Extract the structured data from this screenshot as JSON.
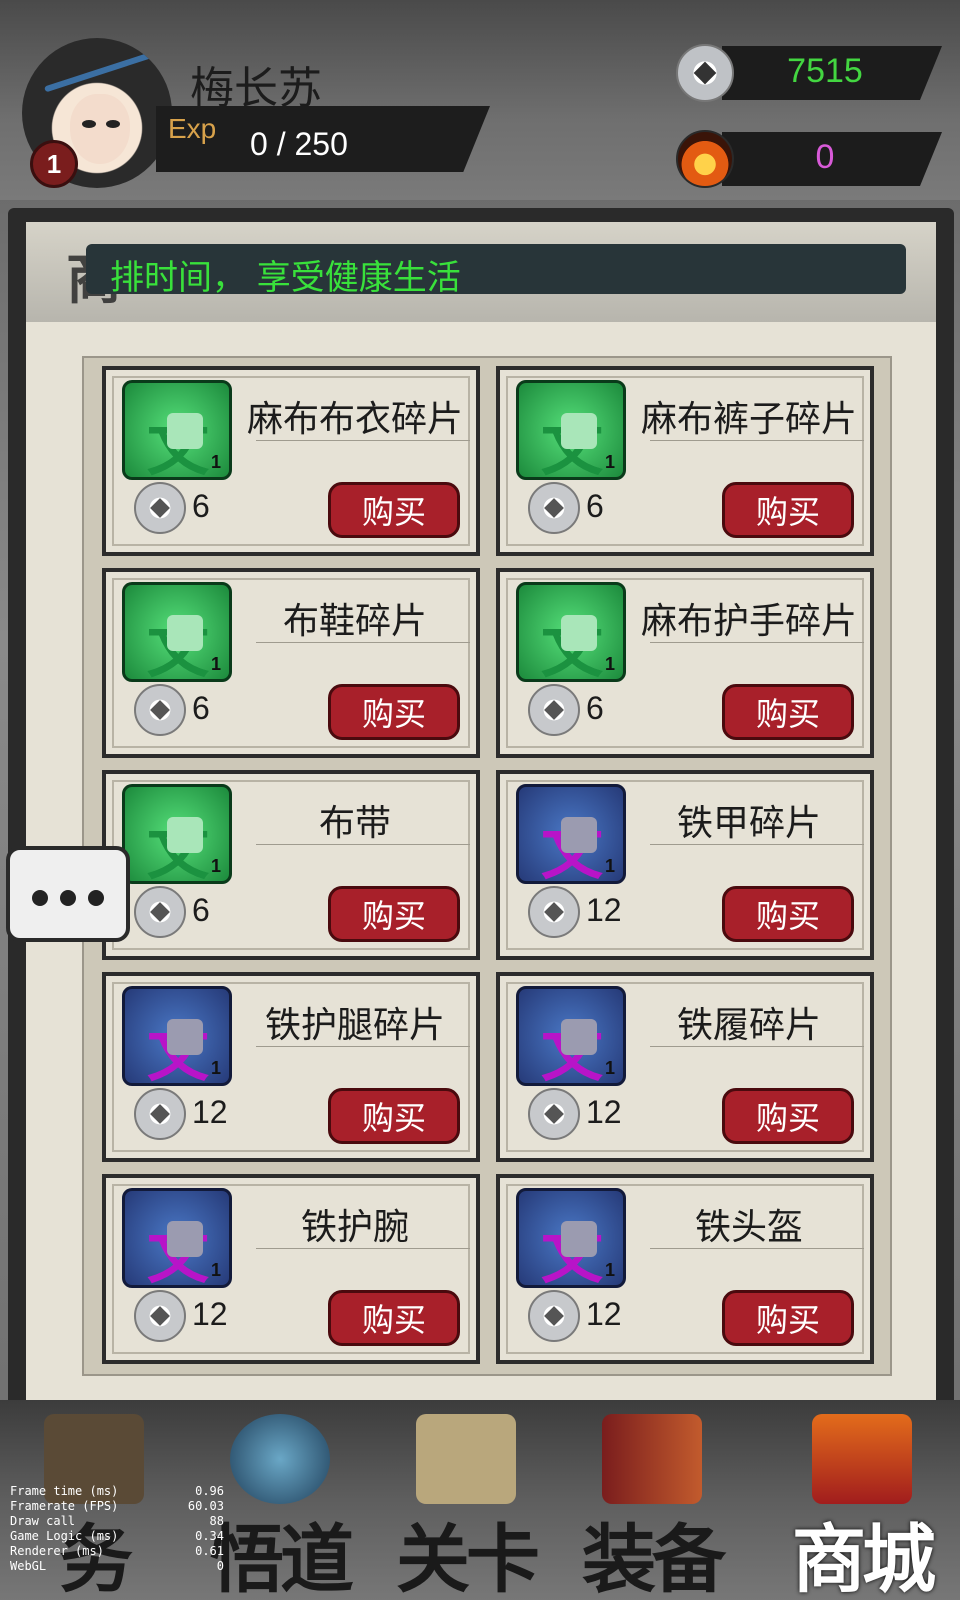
{
  "player": {
    "name": "梅长苏",
    "level": "1",
    "exp_label": "Exp",
    "exp_value": "0 / 250",
    "exp_fraction": 0.0
  },
  "currencies": {
    "coins": "7515",
    "fire": "0"
  },
  "marquee": "排时间， 享受健康生活",
  "shop_items": [
    {
      "name": "麻布布衣碎片",
      "price": "6",
      "count": "1",
      "rarity": "green",
      "buy": "购买"
    },
    {
      "name": "麻布裤子碎片",
      "price": "6",
      "count": "1",
      "rarity": "green",
      "buy": "购买"
    },
    {
      "name": "布鞋碎片",
      "price": "6",
      "count": "1",
      "rarity": "green",
      "buy": "购买"
    },
    {
      "name": "麻布护手碎片",
      "price": "6",
      "count": "1",
      "rarity": "green",
      "buy": "购买"
    },
    {
      "name": "布带",
      "price": "6",
      "count": "1",
      "rarity": "green",
      "buy": "购买"
    },
    {
      "name": "铁甲碎片",
      "price": "12",
      "count": "1",
      "rarity": "purple",
      "buy": "购买"
    },
    {
      "name": "铁护腿碎片",
      "price": "12",
      "count": "1",
      "rarity": "purple",
      "buy": "购买"
    },
    {
      "name": "铁履碎片",
      "price": "12",
      "count": "1",
      "rarity": "purple",
      "buy": "购买"
    },
    {
      "name": "铁护腕",
      "price": "12",
      "count": "1",
      "rarity": "purple",
      "buy": "购买"
    },
    {
      "name": "铁头盔",
      "price": "12",
      "count": "1",
      "rarity": "purple",
      "buy": "购买"
    }
  ],
  "nav": [
    {
      "label": "务",
      "icon": "scroll-icon"
    },
    {
      "label": "悟道",
      "icon": "yin-yang-icon"
    },
    {
      "label": "关卡",
      "icon": "map-icon"
    },
    {
      "label": "装备",
      "icon": "sword-icon"
    },
    {
      "label": "商城",
      "icon": "palace-icon",
      "active": true
    }
  ],
  "debug": [
    {
      "k": "Frame time (ms)",
      "v": "0.96"
    },
    {
      "k": "Framerate (FPS)",
      "v": "60.03"
    },
    {
      "k": "Draw call",
      "v": "88"
    },
    {
      "k": "Game Logic (ms)",
      "v": "0.34"
    },
    {
      "k": "Renderer (ms)",
      "v": "0.61"
    },
    {
      "k": "WebGL",
      "v": "0"
    }
  ],
  "colors": {
    "buy_button": "#a8202a",
    "coin_text": "#43d641",
    "fire_text": "#d85ad8",
    "marquee_text": "#39e13b"
  }
}
